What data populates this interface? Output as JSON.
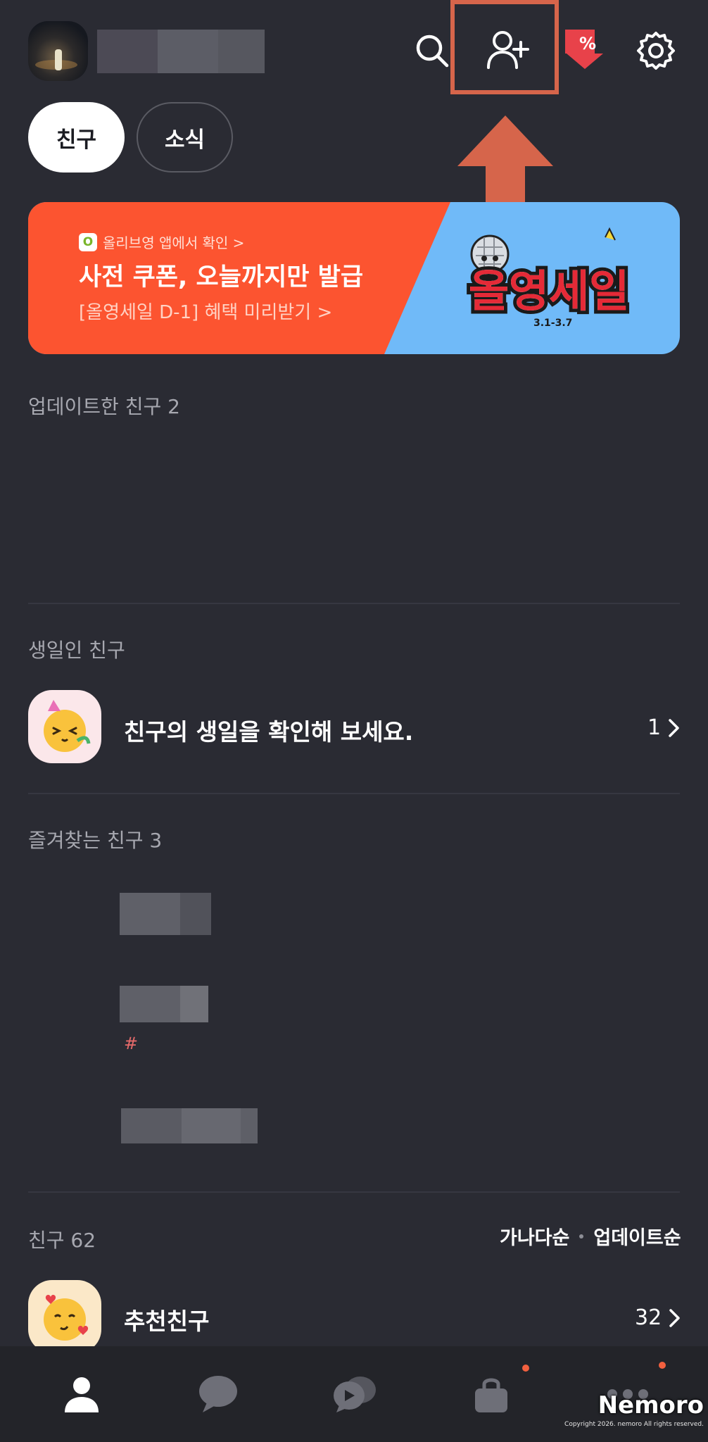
{
  "header": {
    "icons": [
      "search-icon",
      "add-friend-icon",
      "coupon-icon",
      "settings-icon"
    ]
  },
  "tabs": {
    "friends": "친구",
    "news": "소식"
  },
  "banner": {
    "source": "올리브영 앱에서 확인 >",
    "title": "사전 쿠폰, 오늘까지만 발급",
    "link": "[올영세일 D-1] 혜택 미리받기 >",
    "art_title": "올영세일",
    "art_dates": "3.1-3.7"
  },
  "sections": {
    "updated": "업데이트한 친구 2",
    "birthday": "생일인 친구",
    "favorites": "즐겨찾는 친구 3",
    "friends": "친구 62"
  },
  "birthday_row": {
    "text": "친구의 생일을 확인해 보세요.",
    "count": "1"
  },
  "favorites": {
    "hashtag": "#"
  },
  "sort": {
    "alpha": "가나다순",
    "updated": "업데이트순"
  },
  "recommended": {
    "text": "추천친구",
    "count": "32"
  },
  "nav": {
    "items": [
      "friends-tab-icon",
      "chat-tab-icon",
      "openchat-tab-icon",
      "shopping-tab-icon",
      "more-tab-icon"
    ]
  },
  "watermark": {
    "brand": "Nemoro",
    "copyright": "Copyright 2026. nemoro All rights reserved."
  },
  "colors": {
    "background": "#2a2b33",
    "accent": "#d6654b",
    "banner_orange": "#fc5430",
    "banner_blue": "#70baf8"
  }
}
